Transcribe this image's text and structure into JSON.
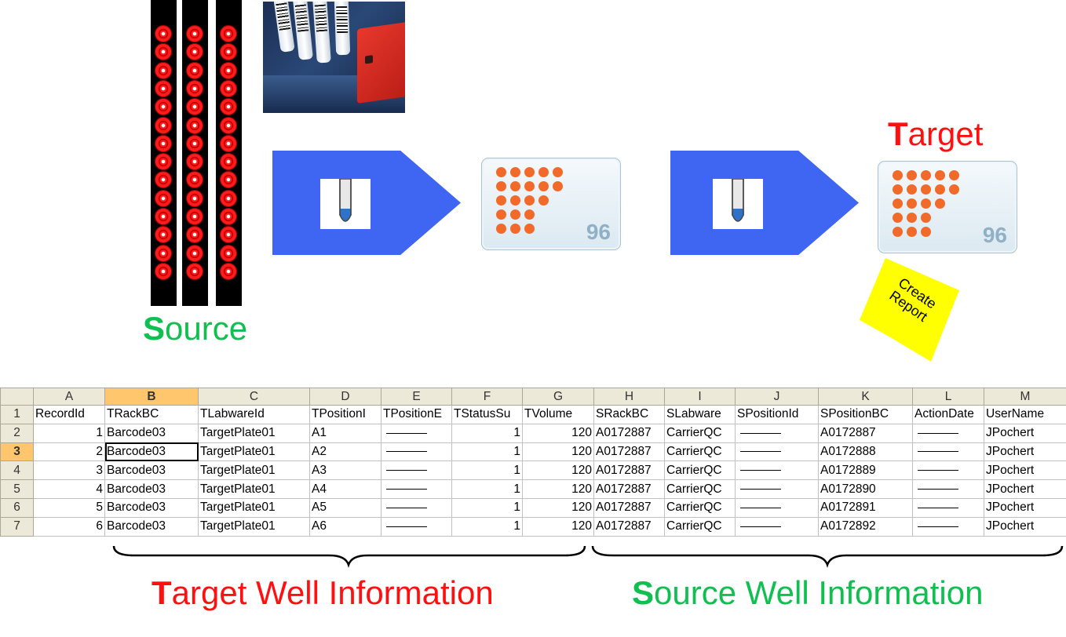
{
  "labels": {
    "source": "Source",
    "target": "Target",
    "target_info": "Target Well Information",
    "source_info": "Source Well Information",
    "create_report": "Create Report"
  },
  "plate_count": "96",
  "colors": {
    "red": "#ff1010",
    "green": "#0fbf4f",
    "arrow": "#3f66f2",
    "well": "#f26a2a",
    "report": "#ffff00"
  },
  "spreadsheet": {
    "columns": [
      "A",
      "B",
      "C",
      "D",
      "E",
      "F",
      "G",
      "H",
      "I",
      "J",
      "K",
      "L",
      "M"
    ],
    "headers": [
      "RecordId",
      "TRackBC",
      "TLabwareId",
      "TPositionI",
      "TPositionE",
      "TStatusSu",
      "TVolume",
      "SRackBC",
      "SLabware",
      "SPositionId",
      "SPositionBC",
      "ActionDate",
      "UserName"
    ],
    "rows": [
      {
        "num": "2",
        "cells": [
          "1",
          "Barcode03",
          "TargetPlate01",
          "A1",
          "",
          "1",
          "120",
          "A0172887",
          "CarrierQC",
          "",
          "A0172887",
          "",
          "JPochert"
        ]
      },
      {
        "num": "3",
        "cells": [
          "2",
          "Barcode03",
          "TargetPlate01",
          "A2",
          "",
          "1",
          "120",
          "A0172887",
          "CarrierQC",
          "",
          "A0172888",
          "",
          "JPochert"
        ]
      },
      {
        "num": "4",
        "cells": [
          "3",
          "Barcode03",
          "TargetPlate01",
          "A3",
          "",
          "1",
          "120",
          "A0172887",
          "CarrierQC",
          "",
          "A0172889",
          "",
          "JPochert"
        ]
      },
      {
        "num": "5",
        "cells": [
          "4",
          "Barcode03",
          "TargetPlate01",
          "A4",
          "",
          "1",
          "120",
          "A0172887",
          "CarrierQC",
          "",
          "A0172890",
          "",
          "JPochert"
        ]
      },
      {
        "num": "6",
        "cells": [
          "5",
          "Barcode03",
          "TargetPlate01",
          "A5",
          "",
          "1",
          "120",
          "A0172887",
          "CarrierQC",
          "",
          "A0172891",
          "",
          "JPochert"
        ]
      },
      {
        "num": "7",
        "cells": [
          "6",
          "Barcode03",
          "TargetPlate01",
          "A6",
          "",
          "1",
          "120",
          "A0172887",
          "CarrierQC",
          "",
          "A0172892",
          "",
          "JPochert"
        ]
      }
    ]
  }
}
